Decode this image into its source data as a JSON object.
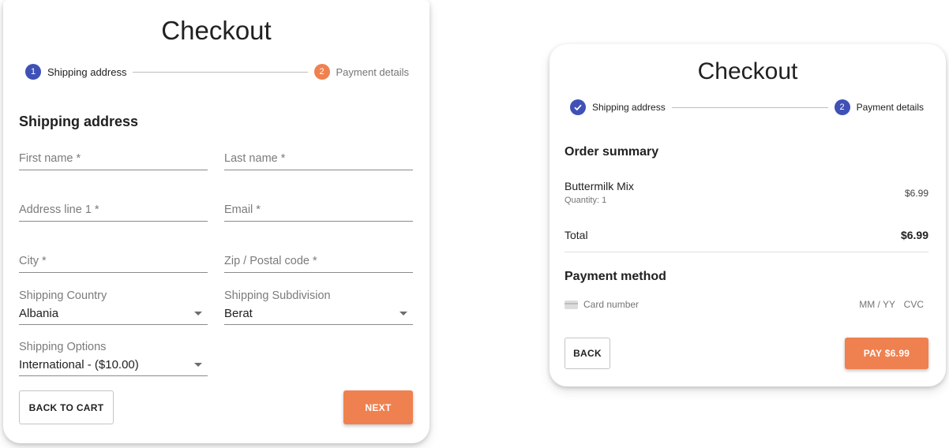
{
  "colors": {
    "primary": "#3f51b5",
    "accent": "#ef8150"
  },
  "shipping_form": {
    "title": "Checkout",
    "steps": [
      {
        "number": "1",
        "label": "Shipping address",
        "state": "active"
      },
      {
        "number": "2",
        "label": "Payment details",
        "state": "inactive"
      }
    ],
    "section_title": "Shipping address",
    "fields": {
      "first_name": {
        "placeholder": "First name *"
      },
      "last_name": {
        "placeholder": "Last name *"
      },
      "address_line1": {
        "placeholder": "Address line 1 *"
      },
      "email": {
        "placeholder": "Email *"
      },
      "city": {
        "placeholder": "City *"
      },
      "zip": {
        "placeholder": "Zip / Postal code *"
      },
      "shipping_country": {
        "label": "Shipping Country",
        "value": "Albania"
      },
      "shipping_subdivision": {
        "label": "Shipping Subdivision",
        "value": "Berat"
      },
      "shipping_options": {
        "label": "Shipping Options",
        "value": "International - ($10.00)"
      }
    },
    "back_button": "BACK TO CART",
    "next_button": "NEXT"
  },
  "payment_form": {
    "title": "Checkout",
    "steps": [
      {
        "number": "",
        "label": "Shipping address",
        "state": "completed"
      },
      {
        "number": "2",
        "label": "Payment details",
        "state": "active"
      }
    ],
    "order_summary_title": "Order summary",
    "items": [
      {
        "name": "Buttermilk Mix",
        "quantity": "Quantity: 1",
        "price": "$6.99"
      }
    ],
    "total_label": "Total",
    "total_value": "$6.99",
    "payment_method_title": "Payment method",
    "card_number_placeholder": "Card number",
    "card_expiry_placeholder": "MM / YY",
    "card_cvc_placeholder": "CVC",
    "back_button": "BACK",
    "pay_button": "PAY $6.99"
  }
}
